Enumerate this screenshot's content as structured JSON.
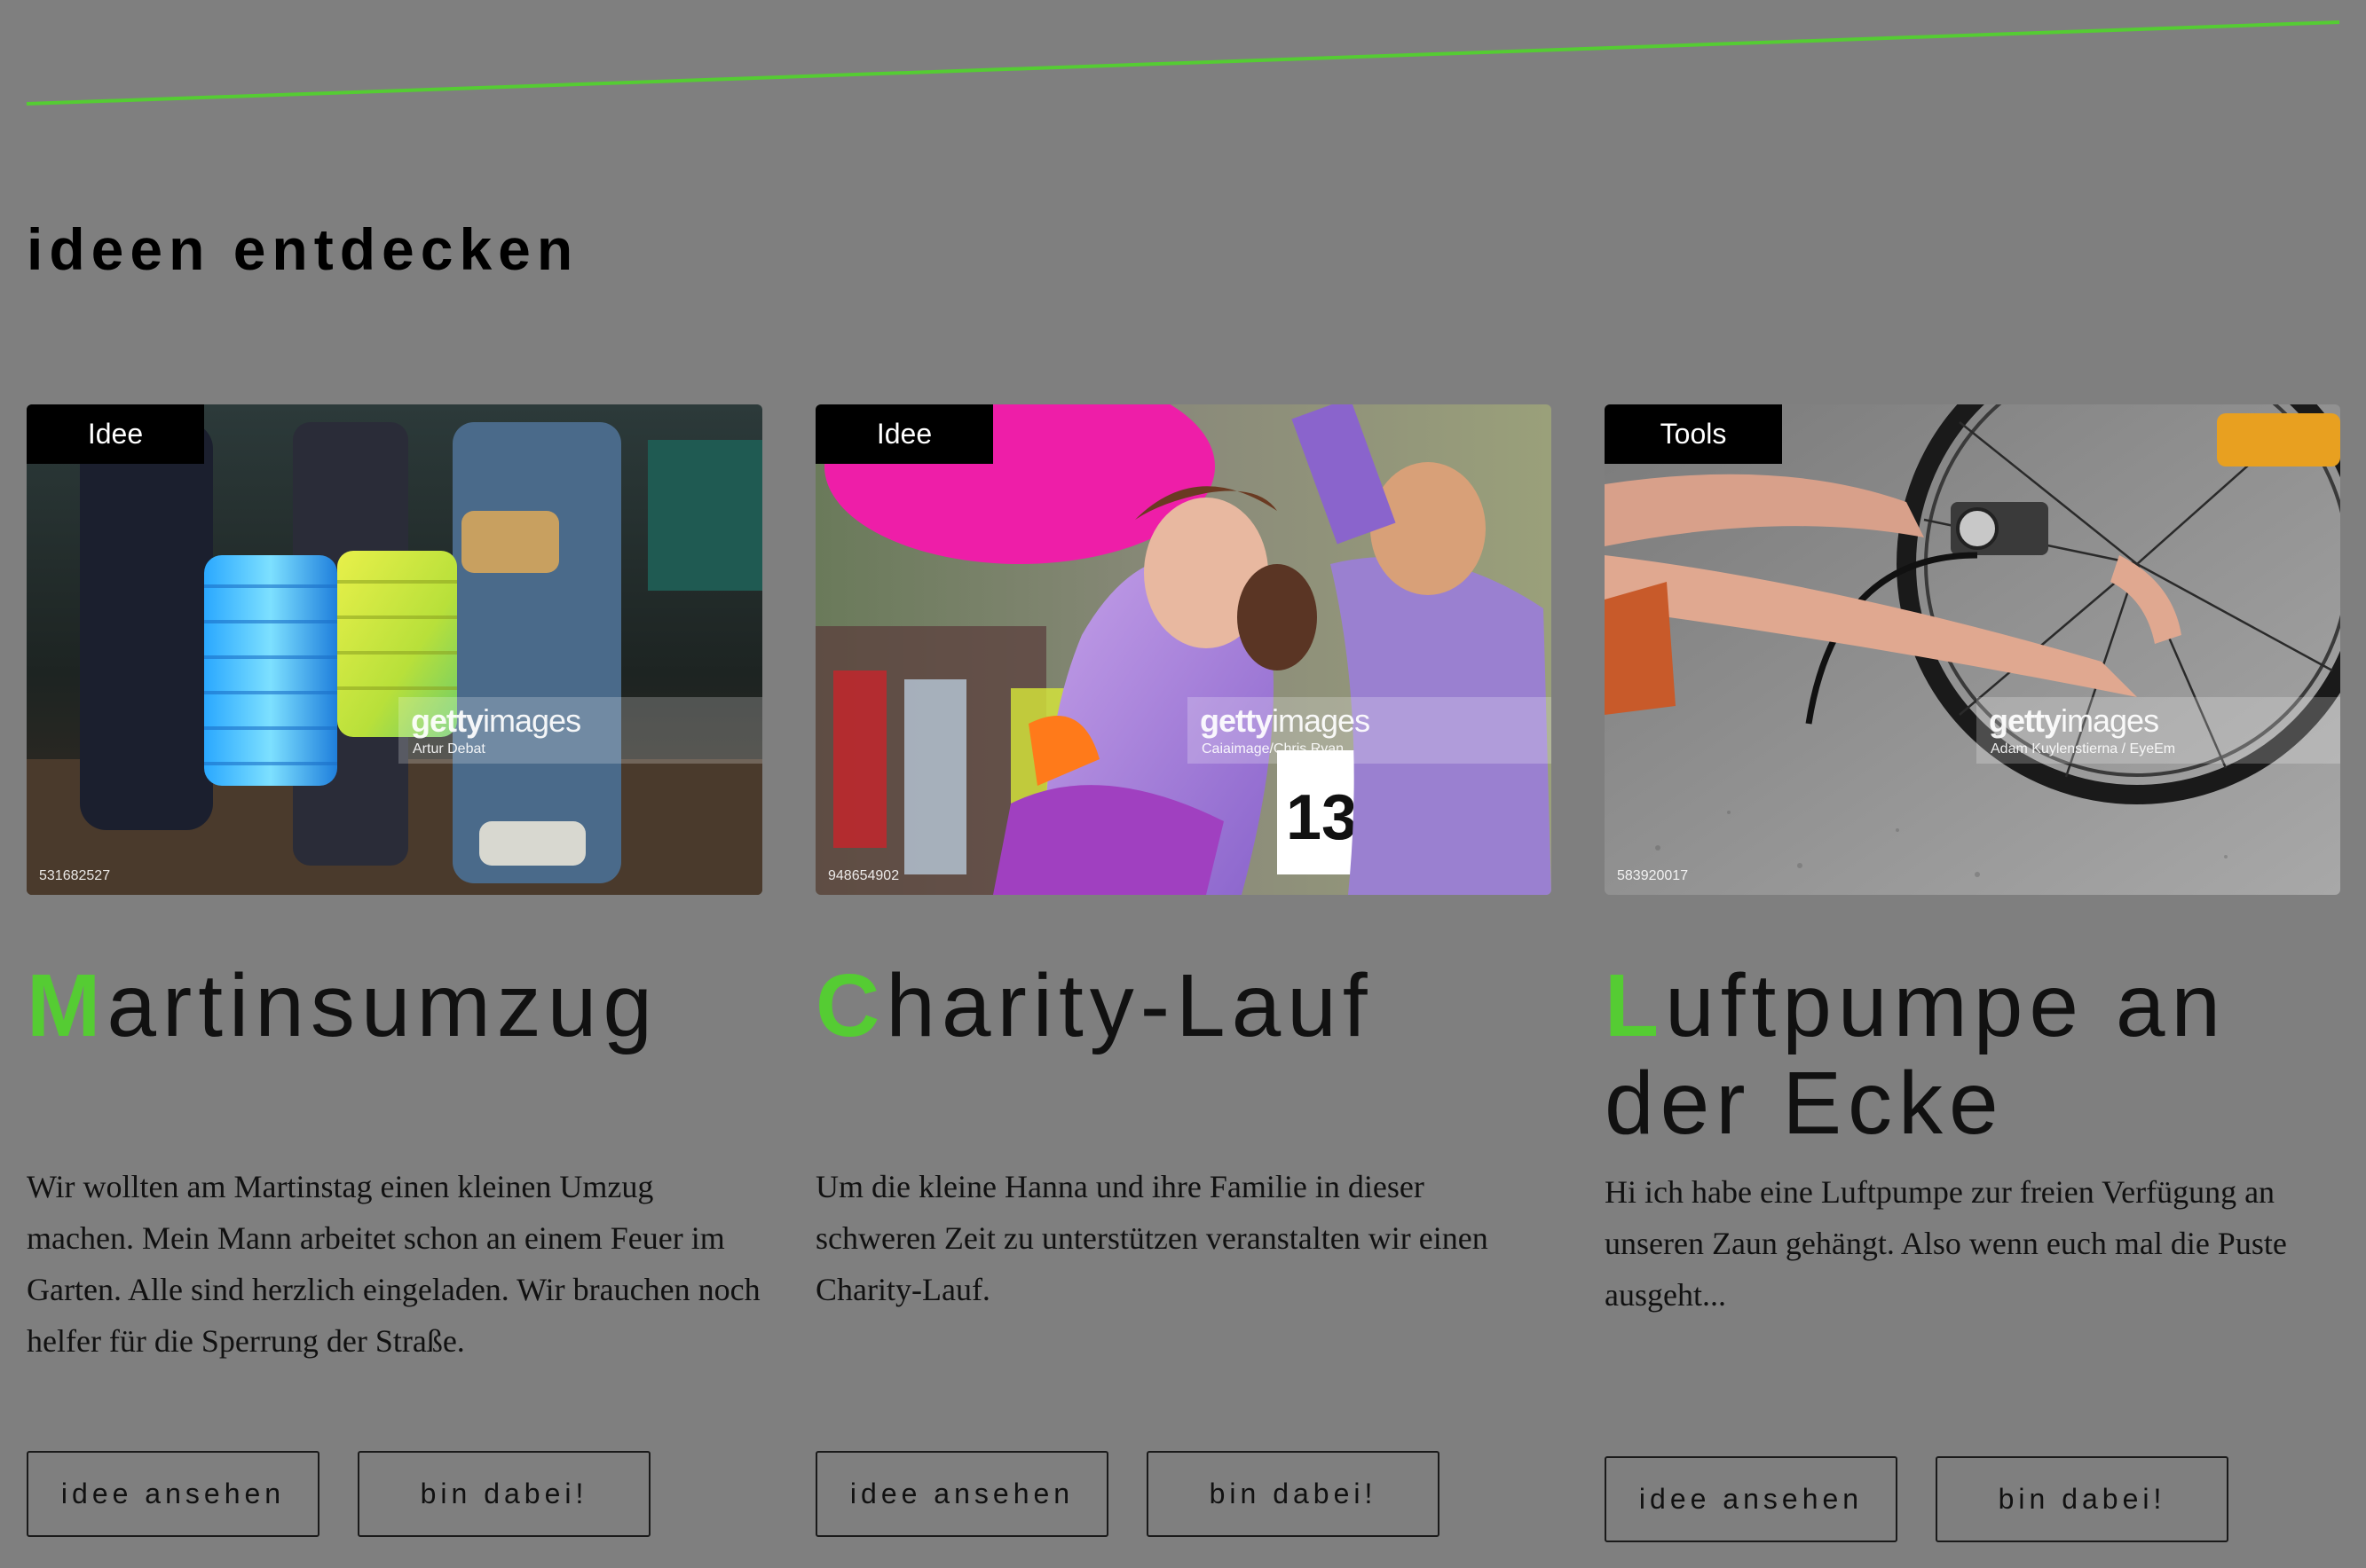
{
  "section": {
    "title": "ideen entdecken"
  },
  "colors": {
    "accent": "#55cc33",
    "background": "#7f7f7f",
    "text": "#111111",
    "tag_bg": "#000000"
  },
  "cards": [
    {
      "tag": "Idee",
      "title_initial": "M",
      "title_rest": "artinsumzug",
      "description": "Wir wollten am Martinstag einen kleinen Umzug machen. Mein Mann arbeitet schon an einem Feuer im Garten. Alle sind herzlich eingeladen. Wir brauchen noch helfer für die Sperrung der Straße.",
      "watermark_brand_bold": "getty",
      "watermark_brand_rest": "images",
      "watermark_credit": "Artur Debat",
      "image_id": "531682527",
      "view_label": "idee ansehen",
      "join_label": "bin dabei!"
    },
    {
      "tag": "Idee",
      "title_initial": "C",
      "title_rest": "harity-Lauf",
      "description": "Um die kleine Hanna und ihre Familie in dieser schweren Zeit zu unterstützen veranstalten wir einen Charity-Lauf.",
      "watermark_brand_bold": "getty",
      "watermark_brand_rest": "images",
      "watermark_credit": "Caiaimage/Chris Ryan",
      "image_id": "948654902",
      "view_label": "idee ansehen",
      "join_label": "bin dabei!"
    },
    {
      "tag": "Tools",
      "title_initial": "L",
      "title_rest": "uftpumpe an der Ecke",
      "description": "Hi ich habe eine Luftpumpe zur freien Verfügung an unseren Zaun gehängt. Also wenn euch mal die Puste ausgeht...",
      "watermark_brand_bold": "getty",
      "watermark_brand_rest": "images",
      "watermark_credit": "Adam Kuylenstierna / EyeEm",
      "image_id": "583920017",
      "view_label": "idee ansehen",
      "join_label": "bin dabei!"
    }
  ]
}
